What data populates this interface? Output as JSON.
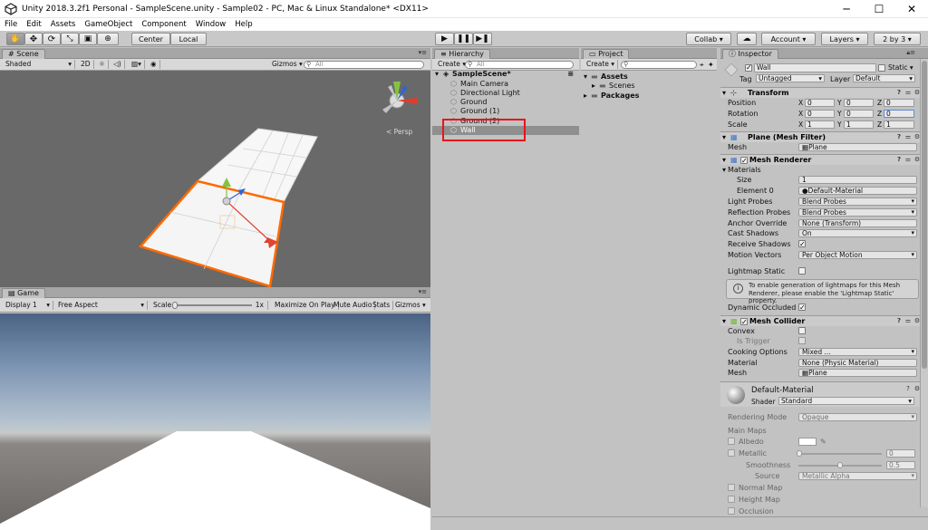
{
  "window": {
    "title": "Unity 2018.3.2f1 Personal - SampleScene.unity - Sample02 - PC, Mac & Linux Standalone* <DX11>",
    "controls": [
      "─",
      "☐",
      "✕"
    ]
  },
  "menu": [
    "File",
    "Edit",
    "Assets",
    "GameObject",
    "Component",
    "Window",
    "Help"
  ],
  "toolbar": {
    "pivot": "Center",
    "space": "Local",
    "collab": "Collab ▾",
    "account": "Account ▾",
    "layers": "Layers ▾",
    "layout": "2 by 3 ▾"
  },
  "scene": {
    "tab": "Scene",
    "shading": "Shaded",
    "mode_2d": "2D",
    "gizmos": "Gizmos ▾",
    "search_placeholder": "All",
    "persp": "< Persp"
  },
  "game": {
    "tab": "Game",
    "display": "Display 1",
    "aspect": "Free Aspect",
    "scale_label": "Scale",
    "scale_value": "1x",
    "maximize": "Maximize On Play",
    "mute": "Mute Audio",
    "stats": "Stats",
    "gizmos": "Gizmos ▾"
  },
  "hierarchy": {
    "tab": "Hierarchy",
    "create": "Create ▾",
    "search_placeholder": "All",
    "scene": "SampleScene*",
    "items": [
      "Main Camera",
      "Directional Light",
      "Ground",
      "Ground (1)",
      "Ground (2)",
      "Wall"
    ],
    "selected": "Wall"
  },
  "project": {
    "tab": "Project",
    "create": "Create ▾",
    "assets": "Assets",
    "scenes": "Scenes",
    "packages": "Packages"
  },
  "inspector": {
    "tab": "Inspector",
    "object_name": "Wall",
    "static": "Static ▾",
    "tag_label": "Tag",
    "tag": "Untagged",
    "layer_label": "Layer",
    "layer": "Default",
    "transform": {
      "title": "Transform",
      "position": {
        "label": "Position",
        "x": "0",
        "y": "0",
        "z": "0"
      },
      "rotation": {
        "label": "Rotation",
        "x": "0",
        "y": "0",
        "z": "0"
      },
      "scale": {
        "label": "Scale",
        "x": "1",
        "y": "1",
        "z": "1"
      }
    },
    "mesh_filter": {
      "title": "Plane (Mesh Filter)",
      "mesh_label": "Mesh",
      "mesh": "Plane"
    },
    "mesh_renderer": {
      "title": "Mesh Renderer",
      "materials": "Materials",
      "size_label": "Size",
      "size": "1",
      "element0_label": "Element 0",
      "element0": "Default-Material",
      "light_probes_label": "Light Probes",
      "light_probes": "Blend Probes",
      "reflection_label": "Reflection Probes",
      "reflection": "Blend Probes",
      "anchor_label": "Anchor Override",
      "anchor": "None (Transform)",
      "cast_label": "Cast Shadows",
      "cast": "On",
      "receive_label": "Receive Shadows",
      "motion_label": "Motion Vectors",
      "motion": "Per Object Motion",
      "lightmap_label": "Lightmap Static",
      "help_line1": "To enable generation of lightmaps for this Mesh",
      "help_line2": "Renderer, please enable the 'Lightmap Static' property.",
      "dynamic_label": "Dynamic Occluded"
    },
    "mesh_collider": {
      "title": "Mesh Collider",
      "convex_label": "Convex",
      "trigger_label": "Is Trigger",
      "cooking_label": "Cooking Options",
      "cooking": "Mixed ...",
      "material_label": "Material",
      "material": "None (Physic Material)",
      "mesh_label": "Mesh",
      "mesh": "Plane"
    },
    "material": {
      "title": "Default-Material",
      "shader_label": "Shader",
      "shader": "Standard",
      "rendering_label": "Rendering Mode",
      "rendering": "Opaque",
      "main_maps": "Main Maps",
      "albedo": "Albedo",
      "metallic": "Metallic",
      "metallic_value": "0",
      "smoothness": "Smoothness",
      "smoothness_value": "0.5",
      "source_label": "Source",
      "source": "Metallic Alpha",
      "normal": "Normal Map",
      "height": "Height Map",
      "occlusion": "Occlusion"
    }
  },
  "colors": {
    "selection_highlight": "#e8141b",
    "plane_outline": "#ff6a00",
    "panel": "#c2c2c2"
  }
}
